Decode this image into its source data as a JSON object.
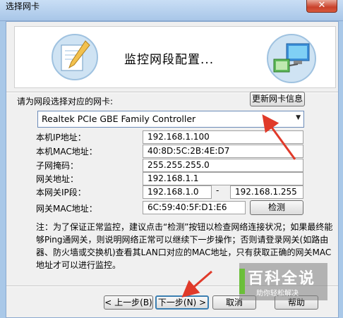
{
  "window": {
    "title": "选择网卡",
    "close_glyph": "✕"
  },
  "banner": {
    "heading": "监控网段配置..."
  },
  "adapter": {
    "prompt": "请为网段选择对应的网卡:",
    "refresh_label": "更新网卡信息",
    "selected": "Realtek PCIe GBE Family Controller"
  },
  "fields": {
    "local_ip": {
      "label": "本机IP地址：",
      "value": "192.168.1.100"
    },
    "local_mac": {
      "label": "本机MAC地址：",
      "value": "40:8D:5C:2B:4E:D7"
    },
    "subnet": {
      "label": "子网掩码：",
      "value": "255.255.255.0"
    },
    "gateway": {
      "label": "网关地址：",
      "value": "192.168.1.1"
    },
    "segment": {
      "label": "本网关IP段：",
      "start": "192.168.1.0",
      "sep": "-",
      "end": "192.168.1.255"
    },
    "gateway_mac": {
      "label": "网关MAC地址：",
      "value": "6C:59:40:5F:D1:E6",
      "detect_label": "检测"
    }
  },
  "note": "注：为了保证正常监控，建议点击“检测”按钮以检查网络连接状况；如果最终能够Ping通网关，则说明网络正常可以继续下一步操作；否则请登录网关(如路由器、防火墙或交换机)查看其LAN口对应的MAC地址，只有获取正确的网关MAC地址才可以进行监控。",
  "buttons": {
    "prev": "< 上一步(B)",
    "next": "下一步(N) >",
    "cancel": "取消",
    "help": "帮助"
  },
  "watermark": {
    "big": "百科全说",
    "small": "助你轻松解决"
  },
  "colors": {
    "arrow": "#e03a2a",
    "title_bg": "#b7d2ef"
  }
}
